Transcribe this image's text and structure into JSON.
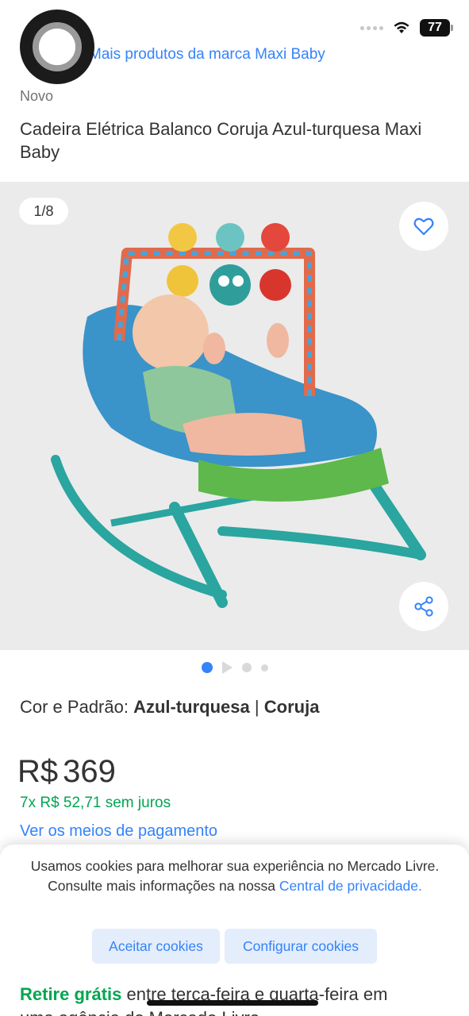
{
  "status_bar": {
    "battery": "77"
  },
  "brand_link": "Mais produtos da marca Maxi Baby",
  "condition": "Novo",
  "product_title": "Cadeira Elétrica Balanco Coruja Azul-turquesa Maxi Baby",
  "gallery": {
    "counter": "1/8",
    "favorite_icon": "heart-icon",
    "share_icon": "share-icon",
    "image_subject": "baby-rocker-chair"
  },
  "variation": {
    "label": "Cor e Padrão:",
    "color": "Azul-turquesa",
    "separator": "|",
    "pattern": "Coruja"
  },
  "price": {
    "currency": "R$",
    "amount": "369",
    "installments": "7x R$ 52,71 sem juros",
    "payment_link": "Ver os meios de pagamento"
  },
  "cookies": {
    "text_before": "Usamos cookies para melhorar sua experiência no Mercado Livre. Consulte mais informações na nossa",
    "privacy_link": "Central de privacidade.",
    "accept_label": "Aceitar cookies",
    "config_label": "Configurar cookies"
  },
  "pickup": {
    "free": "Retire grátis",
    "rest": "entre terça-feira e quarta-feira em",
    "line2": "uma agência do Mercado Livre"
  },
  "colors": {
    "accent": "#3483fa",
    "green": "#00a650",
    "accent_light": "#e3edfb"
  }
}
